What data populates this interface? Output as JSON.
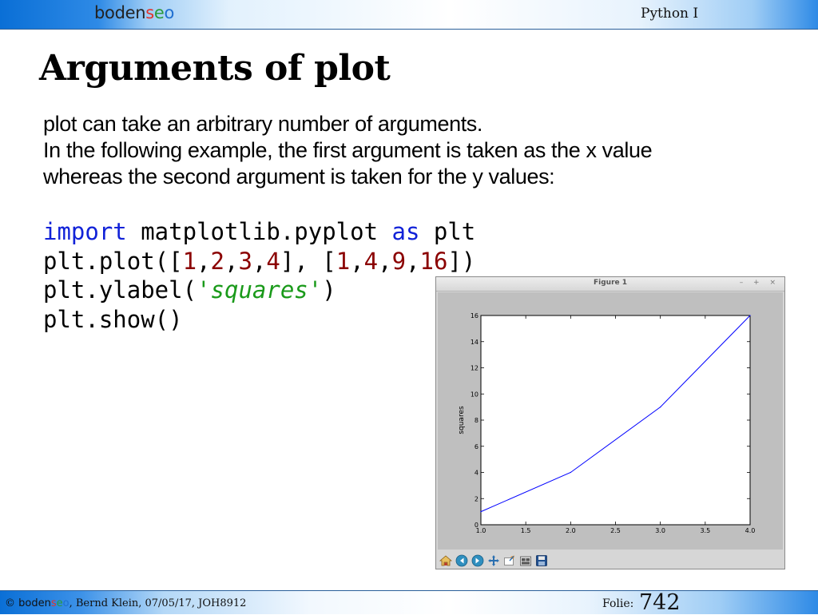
{
  "header": {
    "logo": {
      "part1": "boden",
      "part2_s": "s",
      "part2_e": "e",
      "part2_o": "o"
    },
    "course": "Python I"
  },
  "slide": {
    "title": "Arguments of plot",
    "intro": [
      "plot can take an arbitrary number of arguments.",
      "In the following example, the first argument is taken as the x value",
      "whereas the second argument is taken for the y values:"
    ]
  },
  "code": {
    "line1": {
      "kw1": "import",
      "mid": " matplotlib.pyplot ",
      "kw2": "as",
      "end": " plt"
    },
    "line2": {
      "p0": "plt.plot([",
      "n1": "1",
      "n2": "2",
      "n3": "3",
      "n4": "4",
      "p1": "], [",
      "m1": "1",
      "m2": "4",
      "m3": "9",
      "m4": "16",
      "p2": "])",
      "comma": ","
    },
    "line3": {
      "pre": "plt.ylabel(",
      "str": "'squares'",
      "post": ")"
    },
    "line4": "plt.show()"
  },
  "figure_window": {
    "title": "Figure 1",
    "controls": "– + ×",
    "toolbar_icons": [
      "home-icon",
      "back-arrow-icon",
      "forward-arrow-icon",
      "pan-icon",
      "zoom-icon",
      "subplots-icon",
      "save-icon"
    ]
  },
  "chart_data": {
    "type": "line",
    "x": [
      1,
      2,
      3,
      4
    ],
    "series": [
      {
        "values": [
          1,
          4,
          9,
          16
        ],
        "color": "#0000ff"
      }
    ],
    "title": "",
    "xlabel": "",
    "ylabel": "squares",
    "xlim": [
      1.0,
      4.0
    ],
    "ylim": [
      0,
      16
    ],
    "xticks": [
      1.0,
      1.5,
      2.0,
      2.5,
      3.0,
      3.5,
      4.0
    ],
    "xtick_labels": [
      "1.0",
      "1.5",
      "2.0",
      "2.5",
      "3.0",
      "3.5",
      "4.0"
    ],
    "yticks": [
      0,
      2,
      4,
      6,
      8,
      10,
      12,
      14,
      16
    ],
    "ytick_labels": [
      "0",
      "2",
      "4",
      "6",
      "8",
      "10",
      "12",
      "14",
      "16"
    ],
    "grid": false
  },
  "footer": {
    "copyright_prefix": "© ",
    "logo": {
      "part1": "boden",
      "s": "s",
      "e": "e",
      "o": "o"
    },
    "author": ", Bernd Klein, 07/05/17, JOH8912",
    "folie_label": "Folie:",
    "folie_number": "742"
  },
  "colors": {
    "keyword": "#1122d8",
    "number": "#8b0000",
    "string": "#1a9a1a",
    "line": "#0000ff",
    "header_blue": "#0a6fd6"
  }
}
